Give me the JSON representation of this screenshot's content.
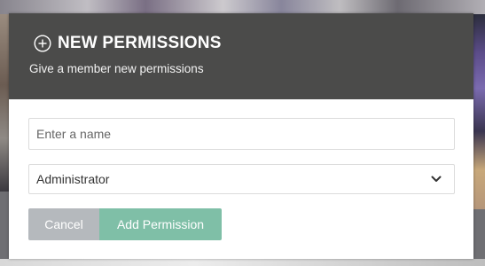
{
  "dialog": {
    "title": "NEW PERMISSIONS",
    "subtitle": "Give a member new permissions",
    "icon": "plus-circle-icon"
  },
  "form": {
    "name_placeholder": "Enter a name",
    "name_value": "",
    "role_selected": "Administrator",
    "role_icon": "chevron-down-icon"
  },
  "actions": {
    "cancel_label": "Cancel",
    "add_label": "Add Permission"
  },
  "colors": {
    "header_bg": "#4b4b4a",
    "cancel_bg": "#b5b9bd",
    "add_bg": "#7fbfa7"
  }
}
